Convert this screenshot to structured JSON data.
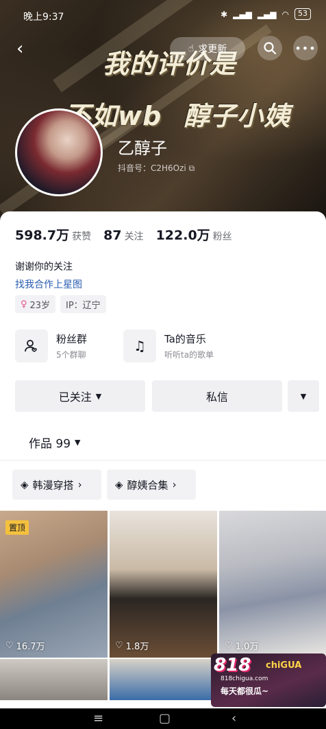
{
  "status": {
    "time": "晚上9:37",
    "battery": "53"
  },
  "header": {
    "update_label": "求更新",
    "overlay_line1": "我的评价是",
    "overlay_line2a": "不如wb",
    "overlay_line2b": "醇子小姨",
    "name": "乙醇子",
    "douyin_id": "抖音号：C2H6Ozi"
  },
  "stats": {
    "likes_num": "598.7万",
    "likes_label": "获赞",
    "following_num": "87",
    "following_label": "关注",
    "followers_num": "122.0万",
    "followers_label": "粉丝"
  },
  "bio": {
    "line1": "谢谢你的关注",
    "line2": "找我合作上星图"
  },
  "tags": {
    "age": "23岁",
    "ip": "IP：辽宁"
  },
  "features": [
    {
      "title": "粉丝群",
      "subtitle": "5个群聊"
    },
    {
      "title": "Ta的音乐",
      "subtitle": "听听ta的歌单"
    }
  ],
  "actions": {
    "followed": "已关注",
    "message": "私信"
  },
  "works": {
    "tab_label": "作品 99"
  },
  "collections": [
    {
      "label": "韩漫穿搭"
    },
    {
      "label": "醇姨合集"
    }
  ],
  "videos": [
    {
      "likes": "16.7万",
      "pinned": "置顶"
    },
    {
      "likes": "1.8万"
    },
    {
      "likes": "1.0万"
    }
  ],
  "watermark": {
    "logo": "818",
    "chi": "chiGUA",
    "url": "818chigua.com",
    "line": "每天都很瓜~"
  }
}
